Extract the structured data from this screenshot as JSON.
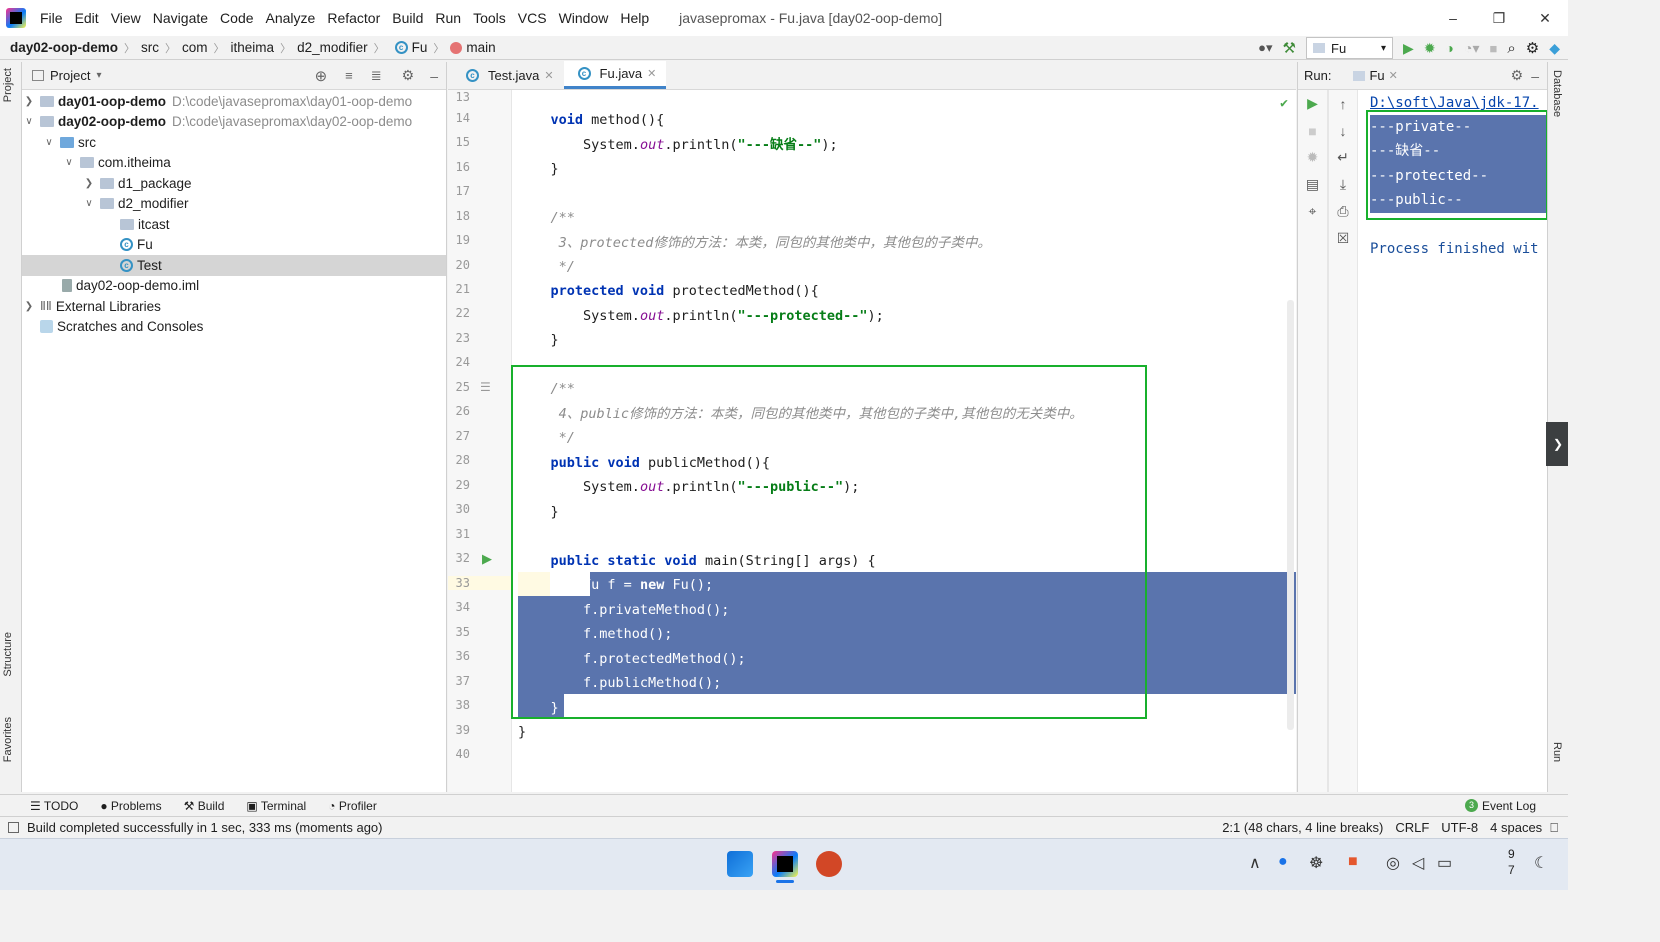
{
  "window": {
    "title": "javasepromax - Fu.java [day02-oop-demo]"
  },
  "menu": [
    "File",
    "Edit",
    "View",
    "Navigate",
    "Code",
    "Analyze",
    "Refactor",
    "Build",
    "Run",
    "Tools",
    "VCS",
    "Window",
    "Help"
  ],
  "breadcrumb": [
    "day02-oop-demo",
    "src",
    "com",
    "itheima",
    "d2_modifier",
    "Fu",
    "main"
  ],
  "run_config": "Fu",
  "project_panel": {
    "title": "Project",
    "tree": [
      {
        "label": "day01-oop-demo",
        "path": "D:\\code\\javasepromax\\day01-oop-demo",
        "bold": true
      },
      {
        "label": "day02-oop-demo",
        "path": "D:\\code\\javasepromax\\day02-oop-demo",
        "bold": true
      },
      {
        "label": "src"
      },
      {
        "label": "com.itheima"
      },
      {
        "label": "d1_package"
      },
      {
        "label": "d2_modifier"
      },
      {
        "label": "itcast"
      },
      {
        "label": "Fu"
      },
      {
        "label": "Test"
      },
      {
        "label": "day02-oop-demo.iml"
      },
      {
        "label": "External Libraries"
      },
      {
        "label": "Scratches and Consoles"
      }
    ]
  },
  "editor": {
    "tabs": [
      {
        "label": "Test.java"
      },
      {
        "label": "Fu.java"
      }
    ],
    "line_numbers": [
      "13",
      "14",
      "15",
      "16",
      "17",
      "18",
      "19",
      "20",
      "21",
      "22",
      "23",
      "24",
      "25",
      "26",
      "27",
      "28",
      "29",
      "30",
      "31",
      "32",
      "33",
      "34",
      "35",
      "36",
      "37",
      "38",
      "39",
      "40"
    ],
    "code": {
      "l13": "*/",
      "l14_kw": "void",
      "l14": " method(){",
      "l15a": "System.",
      "l15b": "out",
      "l15c": ".println(",
      "l15d": "\"---缺省--\"",
      "l15e": ");",
      "l16": "}",
      "l18": "/**",
      "l19a": " 3、",
      "l19b": "protected",
      "l19c": "修饰的方法：本类，同包的其他类中，其他包的子类中。",
      "l20": " */",
      "l21_kw": "protected void",
      "l21": " protectedMethod(){",
      "l22a": "System.",
      "l22b": "out",
      "l22c": ".println(",
      "l22d": "\"---protected--\"",
      "l22e": ");",
      "l23": "}",
      "l25": "/**",
      "l26a": " 4、",
      "l26b": "public",
      "l26c": "修饰的方法：本类，同包的其他类中，其他包的子类中,其他包的无关类中。",
      "l27": " */",
      "l28_kw": "public void",
      "l28": " publicMethod(){",
      "l29a": "System.",
      "l29b": "out",
      "l29c": ".println(",
      "l29d": "\"---public--\"",
      "l29e": ");",
      "l30": "}",
      "l32_kw": "public static void",
      "l32": " main(String[] args) {",
      "l33a": "Fu f = ",
      "l33b": "new",
      "l33c": " Fu();",
      "l34": "f.privateMethod();",
      "l35": "f.method();",
      "l36": "f.protectedMethod();",
      "l37": "f.publicMethod();",
      "l38": "}",
      "l39": "}"
    }
  },
  "run_panel": {
    "label": "Run:",
    "tab": "Fu",
    "lines": [
      "D:\\soft\\Java\\jdk-17.",
      "---private--",
      "---缺省--",
      "---protected--",
      "---public--",
      "",
      "Process finished wit"
    ]
  },
  "side_tabs": {
    "project": "Project",
    "structure": "Structure",
    "favorites": "Favorites",
    "database": "Database",
    "run": "Run"
  },
  "bottom_tools": [
    "TODO",
    "Problems",
    "Build",
    "Terminal",
    "Profiler"
  ],
  "event_log": {
    "badge": "3",
    "label": "Event Log"
  },
  "status": {
    "message": "Build completed successfully in 1 sec, 333 ms (moments ago)",
    "position": "2:1 (48 chars, 4 line breaks)",
    "line_sep": "CRLF",
    "encoding": "UTF-8",
    "indent": "4 spaces"
  },
  "taskbar": {
    "clock_top": "9",
    "clock_bottom": "7"
  },
  "colors": {
    "selection": "#5a74ad",
    "highlight_box": "#18b02c",
    "keyword": "#0033b3",
    "string": "#067d17"
  }
}
